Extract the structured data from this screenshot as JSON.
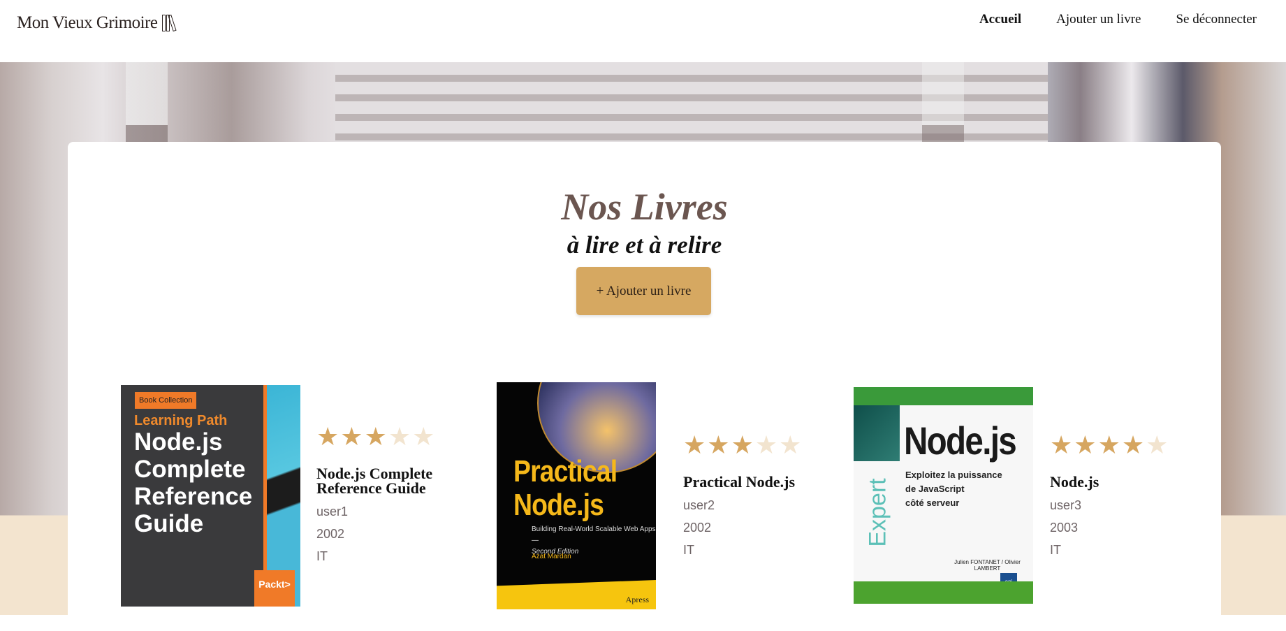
{
  "header": {
    "logo": "Mon Vieux Grimoire",
    "nav": [
      {
        "label": "Accueil",
        "active": true
      },
      {
        "label": "Ajouter un livre"
      },
      {
        "label": "Se déconnecter"
      }
    ]
  },
  "main": {
    "title": "Nos Livres",
    "subtitle": "à lire et à relire",
    "add_button": "+ Ajouter un livre"
  },
  "colors": {
    "accent": "#d6a861",
    "star_on": "#d6a660",
    "star_off": "#f2e4cf"
  },
  "books": [
    {
      "title": "Node.js Complete Reference Guide",
      "user": "user1",
      "year": "2002",
      "genre": "IT",
      "rating": 3,
      "cover": {
        "tag": "Book Collection",
        "series": "Learning Path",
        "title": "Node.js Complete Reference Guide",
        "publisher": "Packt>"
      }
    },
    {
      "title": "Practical Node.js",
      "user": "user2",
      "year": "2002",
      "genre": "IT",
      "rating": 3,
      "cover": {
        "title": "Practical Node.js",
        "subtitle": "Building Real-World Scalable Web Apps",
        "edition": "Second Edition",
        "author": "Azat Mardan",
        "publisher": "Apress"
      }
    },
    {
      "title": "Node.js",
      "user": "user3",
      "year": "2003",
      "genre": "IT",
      "rating": 4,
      "cover": {
        "series": "Expert",
        "title": "Node.js",
        "subtitle1": "Exploitez la puissance",
        "subtitle2": "de JavaScript",
        "subtitle3": "côté serveur",
        "authors": "Julien FONTANET / Olivier LAMBERT",
        "publisher": "eni"
      }
    }
  ]
}
